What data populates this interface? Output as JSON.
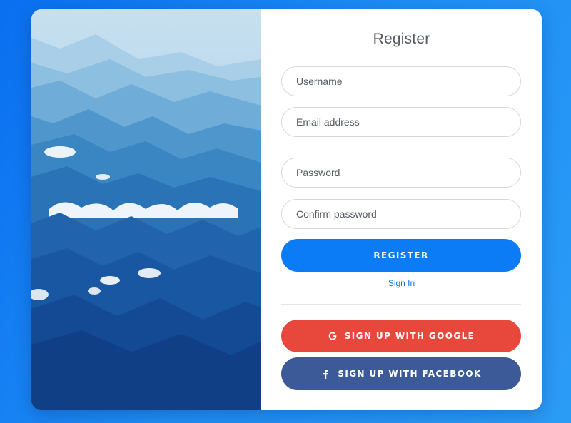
{
  "form": {
    "title": "Register",
    "username_placeholder": "Username",
    "email_placeholder": "Email address",
    "password_placeholder": "Password",
    "confirm_password_placeholder": "Confirm password",
    "register_label": "REGISTER",
    "signin_label": "Sign In",
    "google_label": "SIGN UP WITH GOOGLE",
    "facebook_label": "SIGN UP WITH FACEBOOK"
  },
  "icons": {
    "google": "google-icon",
    "facebook": "facebook-icon"
  },
  "colors": {
    "page_background": "#1e8ef5",
    "register_button": "#0b7cf6",
    "google_button": "#e8473b",
    "facebook_button": "#3c5998",
    "link": "#1a6fd6"
  }
}
